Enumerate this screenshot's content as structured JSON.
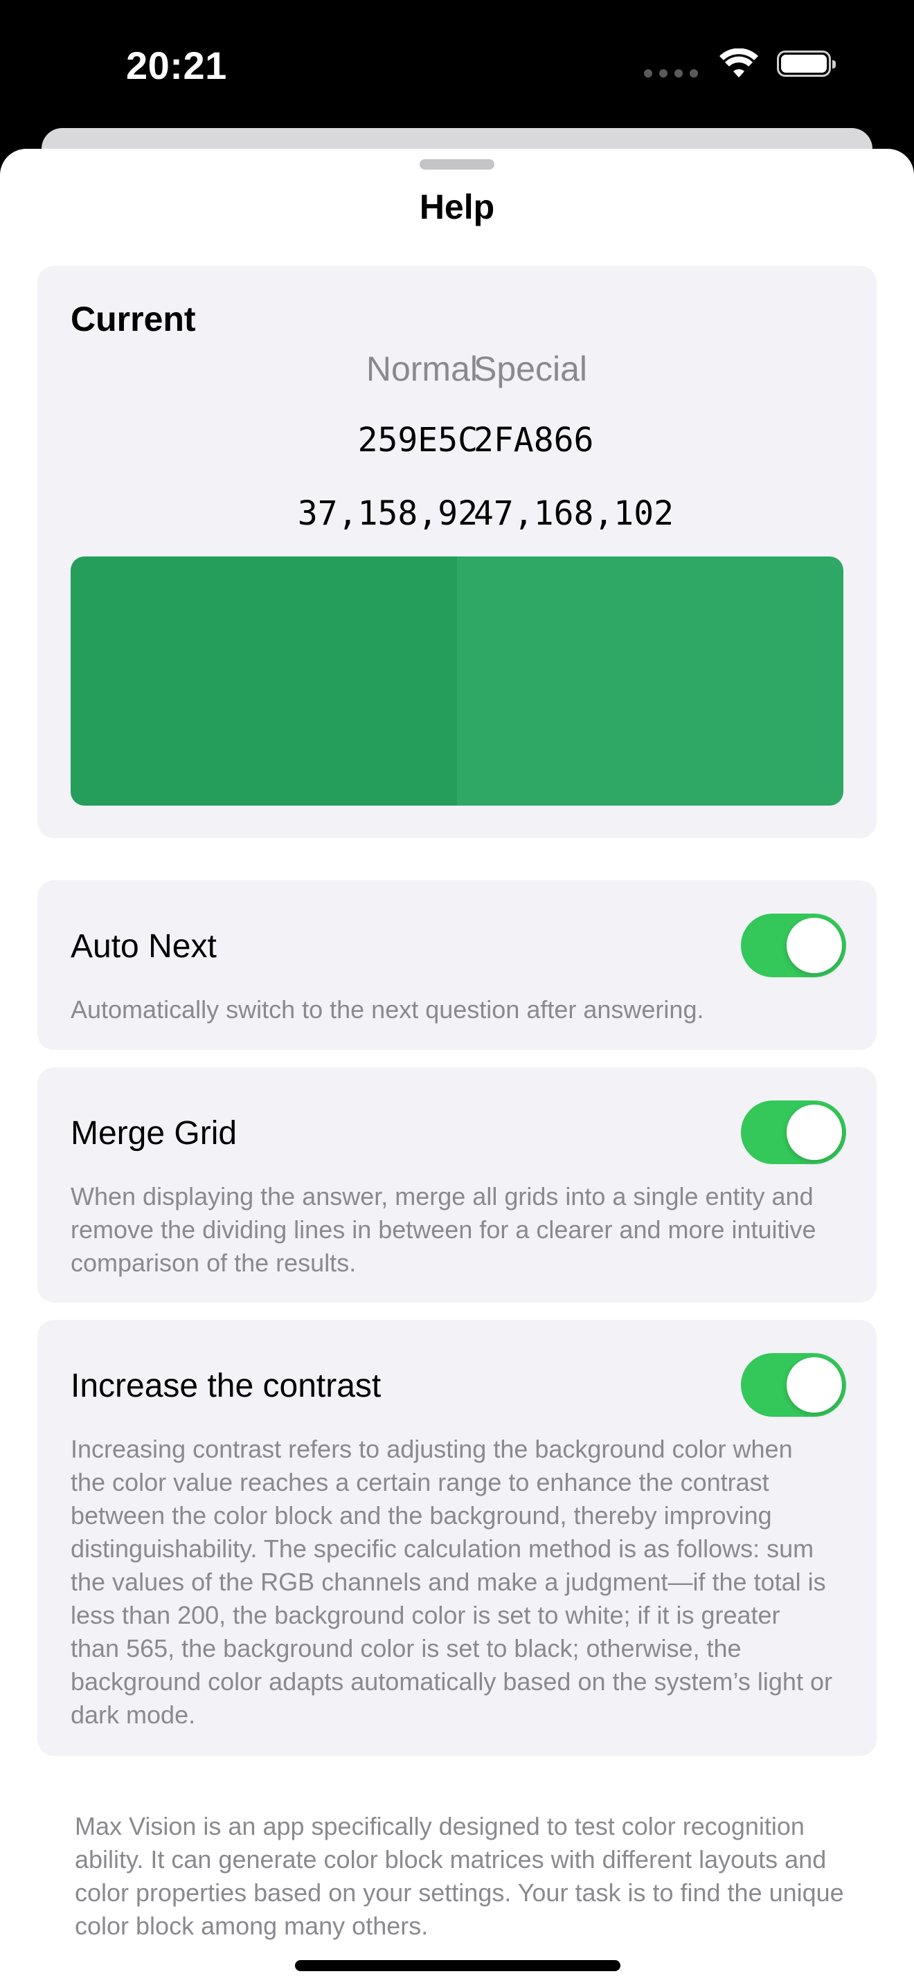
{
  "status_bar": {
    "time": "20:21"
  },
  "sheet": {
    "title": "Help"
  },
  "current": {
    "title": "Current",
    "columns": [
      "Normal",
      "Special"
    ],
    "hex": [
      "259E5C",
      "2FA866"
    ],
    "rgb": [
      "37,158,92",
      "47,168,102"
    ],
    "colors": {
      "normal": "#259E5C",
      "special": "#2FA866"
    }
  },
  "settings": [
    {
      "title": "Auto Next",
      "description": "Automatically switch to the next question after answering.",
      "enabled": true
    },
    {
      "title": "Merge Grid",
      "description": "When displaying the answer, merge all grids into a single entity and remove the dividing lines in between for a clearer and more intuitive comparison of the results.",
      "enabled": true
    },
    {
      "title": "Increase the contrast",
      "description": "Increasing contrast refers to adjusting the background color when the color value reaches a certain range to enhance the contrast between the color block and the background, thereby improving distinguishability. The specific calculation method is as follows: sum the values of the RGB channels and make a judgment—if the total is less than 200, the background color is set to white; if it is greater than 565, the background color is set to black; otherwise, the background color adapts automatically based on the system’s light or dark mode.",
      "enabled": true
    }
  ],
  "footer": "Max Vision is an app specifically designed to test color recognition ability. It can generate color block matrices with different layouts and color properties based on your settings. Your task is to find the unique color block among many others.",
  "accent": "#34C759"
}
